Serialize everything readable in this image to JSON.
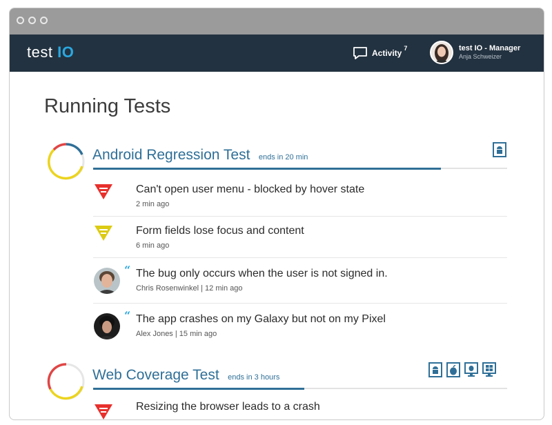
{
  "nav": {
    "logo_text": "test",
    "logo_accent": "IO",
    "activity_label": "Activity",
    "activity_count": "7",
    "user_role": "test IO - Manager",
    "user_name": "Anja Schweizer"
  },
  "page": {
    "title": "Running Tests"
  },
  "tests": [
    {
      "name": "Android Regression Test",
      "ends": "ends in 20 min",
      "progress": 0.84,
      "platforms": [
        "android-icon"
      ],
      "items": [
        {
          "kind": "bug",
          "severity": "critical",
          "title": "Can't open user menu - blocked by hover state",
          "meta": "2 min ago"
        },
        {
          "kind": "bug",
          "severity": "high",
          "title": "Form fields lose focus and content",
          "meta": "6 min ago"
        },
        {
          "kind": "comment",
          "title": "The bug only occurs when the user is not signed in.",
          "meta": "Chris Rosenwinkel | 12 min ago"
        },
        {
          "kind": "comment",
          "title": "The app crashes on my Galaxy but not on my Pixel",
          "meta": "Alex Jones | 15 min ago"
        }
      ]
    },
    {
      "name": "Web Coverage Test",
      "ends": "ends in 3 hours",
      "progress": 0.51,
      "platforms": [
        "android-icon",
        "ios-icon",
        "mac-icon",
        "windows-icon"
      ],
      "items": [
        {
          "kind": "bug",
          "severity": "critical",
          "title": "Resizing the browser leads to a crash",
          "meta": ""
        }
      ]
    }
  ],
  "colors": {
    "navbar": "#233240",
    "accent": "#2f6f97",
    "critical": "#e8302c",
    "high": "#dccb14",
    "ring_red": "#e04646",
    "ring_yellow": "#ecd41e",
    "ring_blue": "#2f6f97"
  }
}
